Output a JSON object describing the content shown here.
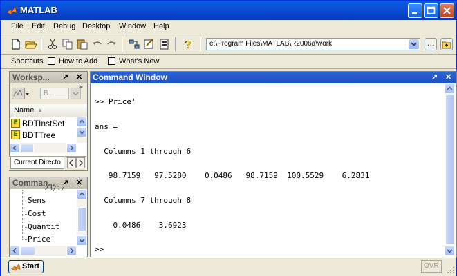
{
  "window": {
    "title": "MATLAB"
  },
  "menu": [
    "File",
    "Edit",
    "Debug",
    "Desktop",
    "Window",
    "Help"
  ],
  "toolbar": {
    "current_directory": "e:\\Program Files\\MATLAB\\R2006a\\work",
    "browse_label": "..."
  },
  "shortcuts": {
    "label": "Shortcuts",
    "items": [
      "How to Add",
      "What's New"
    ]
  },
  "workspace": {
    "title": "Worksp...",
    "dock_glyph": "↗",
    "close_glyph": "✕",
    "more_glyph": "»",
    "stack_value": "B...",
    "name_header": "Name",
    "sort_glyph": "▲",
    "items": [
      "BDTInstSet",
      "BDTTree"
    ],
    "tabs": [
      "Current Directo"
    ]
  },
  "history": {
    "title": "Comman...",
    "dock_glyph": "↗",
    "close_glyph": "✕",
    "partial_top": "23/1/",
    "items": [
      "Sens",
      "Cost",
      "Quantit",
      "Price'"
    ]
  },
  "command_window": {
    "title": "Command Window",
    "dock_glyph": "↗",
    "close_glyph": "✕",
    "lines": [
      ">> Price'",
      "ans =",
      "  Columns 1 through 6",
      "   98.7159   97.5280    0.0486   98.7159  100.5529    6.2831",
      "  Columns 7 through 8",
      "    0.0486    3.6923",
      ">>"
    ]
  },
  "status": {
    "start_label": "Start",
    "ovr": "OVR"
  },
  "colors": {
    "titlebar": "#0a4fd6",
    "panel_active": "#1d4fc1",
    "face": "#ece9d8"
  }
}
